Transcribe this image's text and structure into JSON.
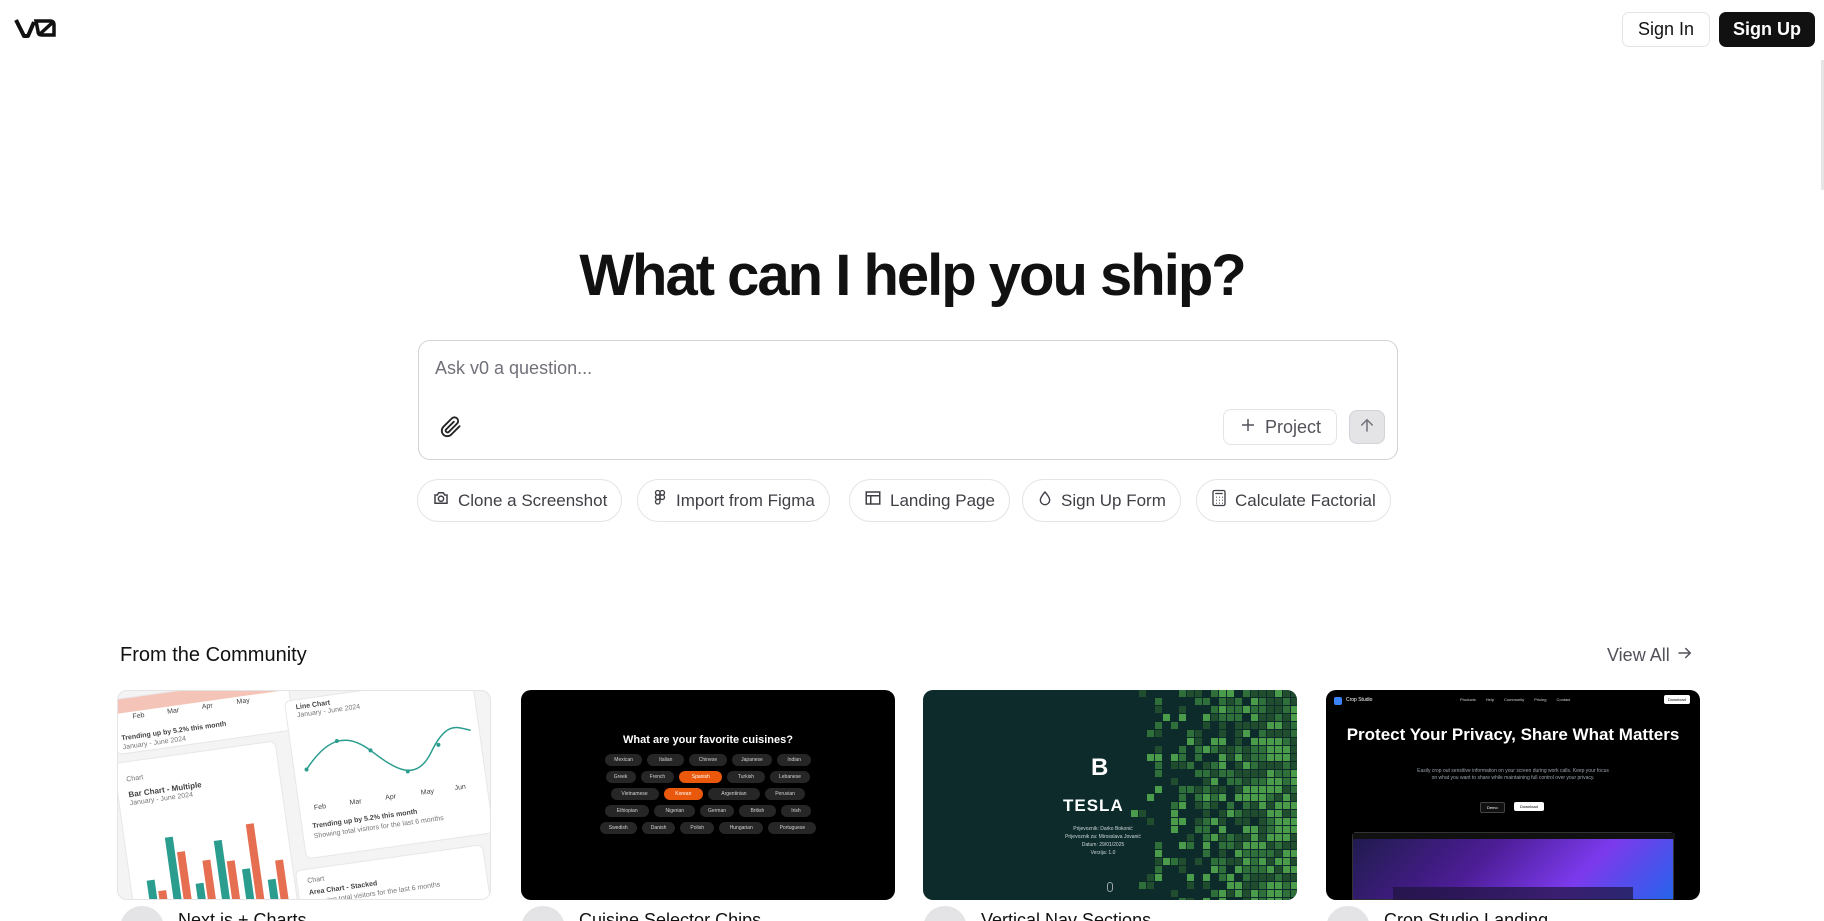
{
  "header": {
    "logo_text": "v0",
    "sign_in_label": "Sign In",
    "sign_up_label": "Sign Up"
  },
  "hero": {
    "title": "What can I help you ship?",
    "prompt_placeholder": "Ask v0 a question...",
    "project_label": "Project"
  },
  "chips": [
    {
      "label": "Clone a Screenshot",
      "icon": "camera-icon"
    },
    {
      "label": "Import from Figma",
      "icon": "figma-icon"
    },
    {
      "label": "Landing Page",
      "icon": "layout-icon"
    },
    {
      "label": "Sign Up Form",
      "icon": "droplet-icon"
    },
    {
      "label": "Calculate Factorial",
      "icon": "calculator-icon"
    }
  ],
  "community": {
    "title": "From the Community",
    "view_all_label": "View All",
    "cards": [
      {
        "title": "Next.js + Charts"
      },
      {
        "title": "Cuisine Selector Chips"
      },
      {
        "title": "Vertical Nav Sections"
      },
      {
        "title": "Crop Studio Landing"
      }
    ]
  },
  "card_charts": {
    "months": [
      "Feb",
      "Mar",
      "Apr",
      "May",
      "Jun"
    ],
    "line_label": "Line Chart",
    "date_range": "January - June 2024",
    "trend": "Trending up by 5.2% this month",
    "chart_label": "Chart",
    "bar_title": "Bar Chart - Multiple",
    "visitors_text": "Showing total visitors for the last 6 months",
    "area_title": "Area Chart - Stacked"
  },
  "card_cuisine": {
    "title": "What are your favorite cuisines?",
    "items": [
      "Mexican",
      "Italian",
      "Chinese",
      "Japanese",
      "Indian",
      "Greek",
      "French",
      "Spanish",
      "Turkish",
      "Lebanese",
      "Vietnamese",
      "Korean",
      "Argentinian",
      "Peruvian",
      "Ethiopian",
      "Nigerian",
      "German",
      "British",
      "Irish",
      "Swedish",
      "Danish",
      "Polish",
      "Hungarian",
      "Portuguese"
    ],
    "selected": [
      "Spanish",
      "Korean"
    ]
  },
  "card_tesla": {
    "logo": "B",
    "name": "TESLA",
    "lines": [
      "Prijevoznik: Darko Bokonić",
      "Prijevoznik za: Mirosslava Jovanić",
      "Datum: 29/01/2025",
      "Verzija: 1.0"
    ]
  },
  "card_crop": {
    "brand": "Crop Studio",
    "nav": [
      "Products",
      "Help",
      "Community",
      "Pricing",
      "Contact"
    ],
    "download_label": "Download",
    "title": "Protect Your Privacy, Share What Matters",
    "subtitle": "Easily crop out sensitive information on your screen during work calls. Keep your focus on what you want to share while maintaining full control over your privacy.",
    "demo_label": "Demo",
    "download_btn": "Download"
  }
}
